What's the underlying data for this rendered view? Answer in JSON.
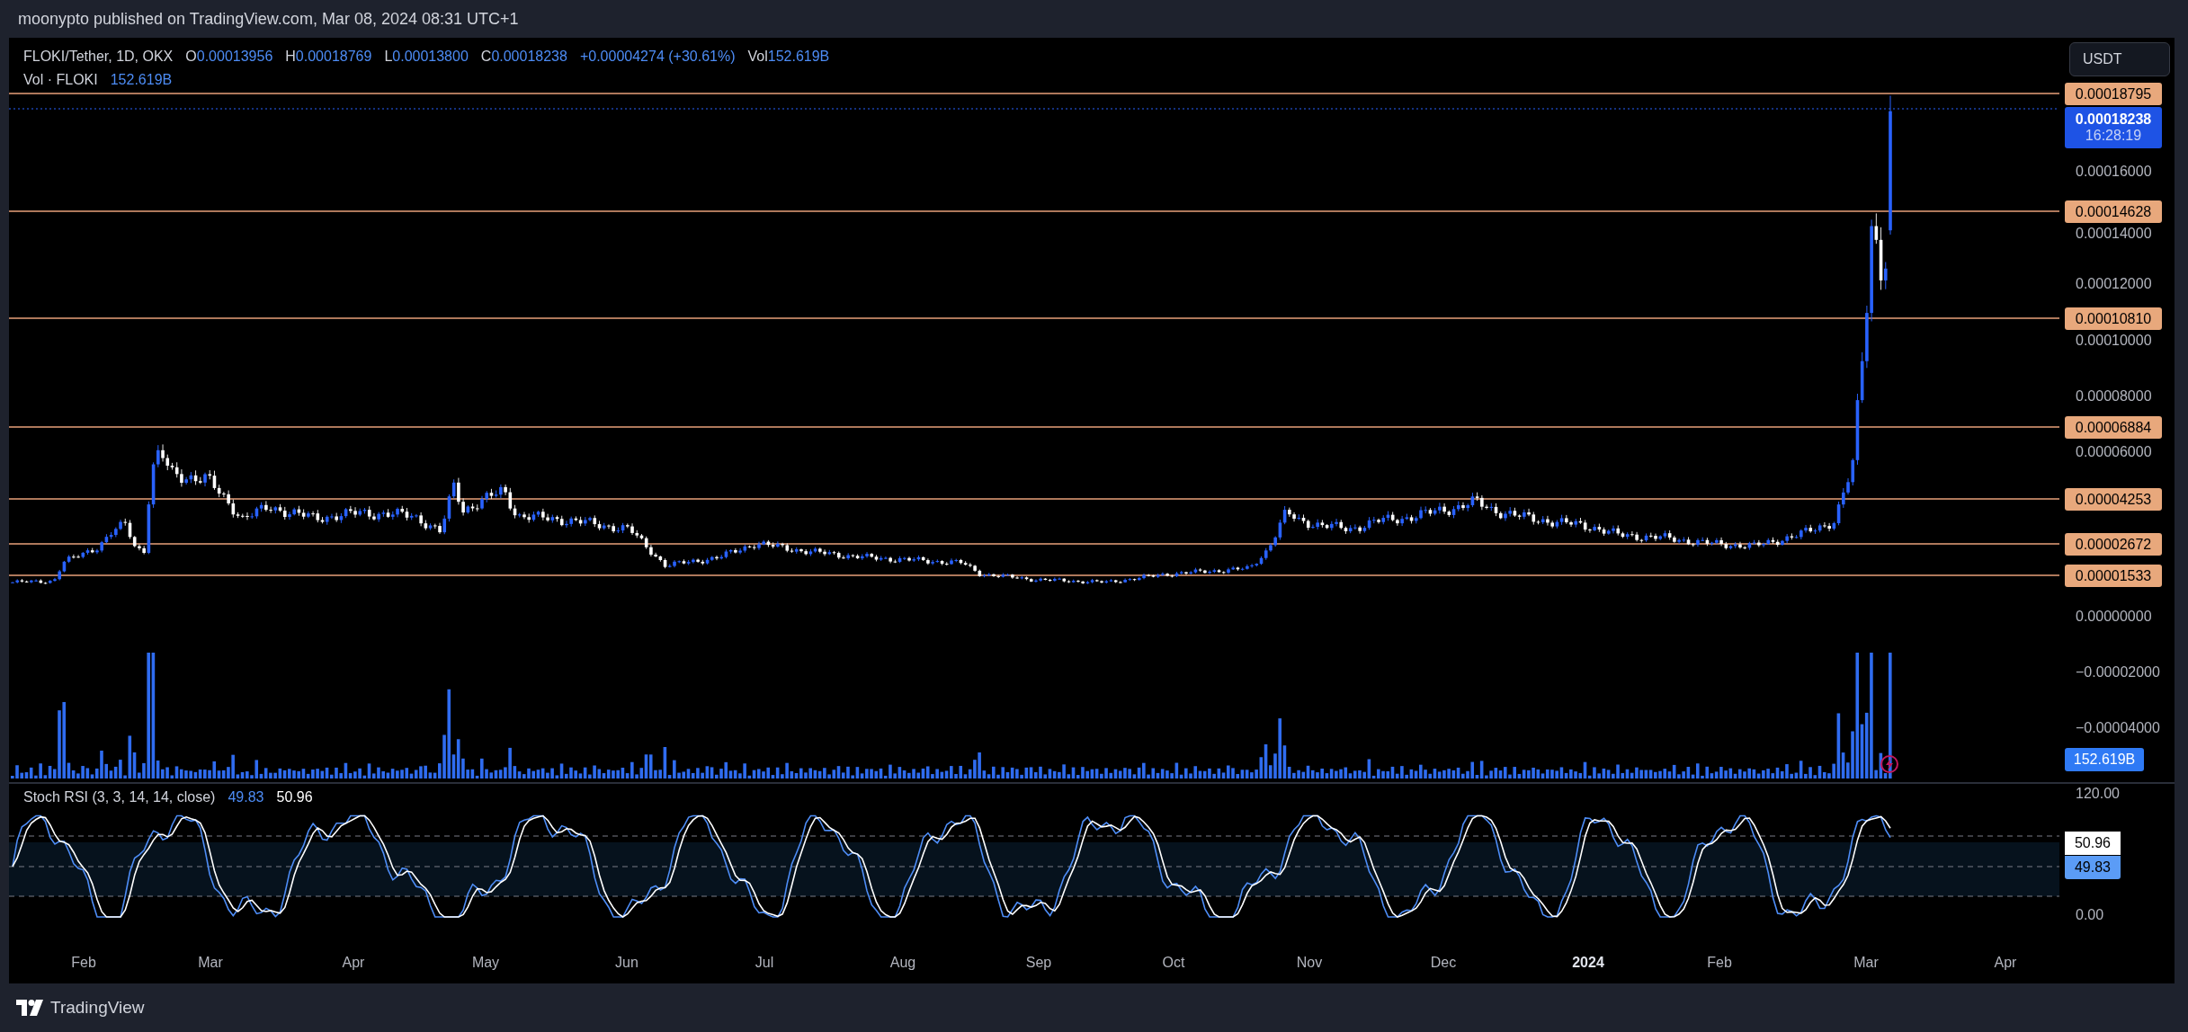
{
  "header": {
    "text": "moonypto published on TradingView.com, Mar 08, 2024 08:31 UTC+1"
  },
  "legend": {
    "symbol": "FLOKI/Tether, 1D, OKX",
    "ohlc": [
      {
        "label": "O",
        "value": "0.00013956"
      },
      {
        "label": "H",
        "value": "0.00018769"
      },
      {
        "label": "L",
        "value": "0.00013800"
      },
      {
        "label": "C",
        "value": "0.00018238"
      }
    ],
    "change": "+0.00004274 (+30.61%)",
    "volume_label": "Vol",
    "volume_value": "152.619B"
  },
  "volume_legend": {
    "label": "Vol · FLOKI",
    "value": "152.619B"
  },
  "currency_button": "USDT",
  "price_axis": {
    "ticks": [
      "0.00016000",
      "0.00014000",
      "0.00012000",
      "0.00010000",
      "0.00008000",
      "0.00006000",
      "0.00000000",
      "−0.00002000",
      "−0.00004000"
    ],
    "levels": [
      "0.00018795",
      "0.00014628",
      "0.00010810",
      "0.00006884",
      "0.00004253",
      "0.00002672",
      "0.00001533"
    ],
    "last_price": {
      "price": "0.00018238",
      "countdown": "16:28:19"
    },
    "volume_value": "152.619B"
  },
  "stoch_rsi": {
    "title": "Stoch RSI (3, 3, 14, 14, close)",
    "k": "49.83",
    "d": "50.96",
    "axis_ticks": [
      "120.00",
      "0.00"
    ],
    "d_badge": "50.96",
    "k_badge": "49.83"
  },
  "time_axis": [
    {
      "label": "Feb",
      "kind": "month"
    },
    {
      "label": "Mar",
      "kind": "month"
    },
    {
      "label": "Apr",
      "kind": "month"
    },
    {
      "label": "May",
      "kind": "month"
    },
    {
      "label": "Jun",
      "kind": "month"
    },
    {
      "label": "Jul",
      "kind": "month"
    },
    {
      "label": "Aug",
      "kind": "month"
    },
    {
      "label": "Sep",
      "kind": "month"
    },
    {
      "label": "Oct",
      "kind": "month"
    },
    {
      "label": "Nov",
      "kind": "month"
    },
    {
      "label": "Dec",
      "kind": "month"
    },
    {
      "label": "2024",
      "kind": "year"
    },
    {
      "label": "Feb",
      "kind": "month"
    },
    {
      "label": "Mar",
      "kind": "month"
    },
    {
      "label": "Apr",
      "kind": "month"
    }
  ],
  "footer": {
    "brand": "TradingView"
  }
}
